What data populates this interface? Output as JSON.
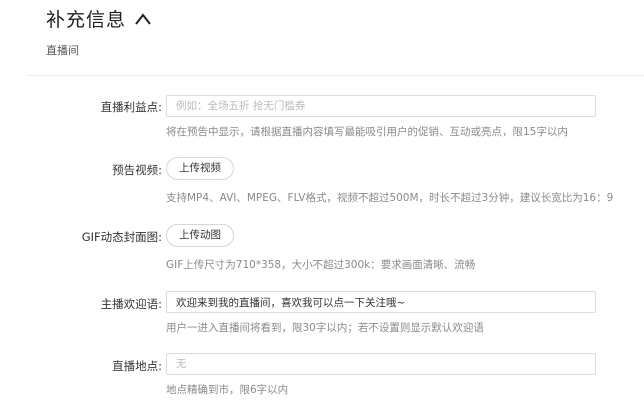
{
  "header": {
    "title": "补充信息"
  },
  "section": {
    "subtitle": "直播间"
  },
  "fields": {
    "selling_point": {
      "label": "直播利益点:",
      "placeholder": "例如：全场五折 抢无门槛券",
      "value": "",
      "hint": "将在预告中显示，请根据直播内容填写最能吸引用户的促销、互动或亮点，限15字以内"
    },
    "preview_video": {
      "label": "预告视频:",
      "button": "上传视频",
      "hint": "支持MP4、AVI、MPEG、FLV格式，视频不超过500M，时长不超过3分钟，建议长宽比为16：9"
    },
    "gif_cover": {
      "label": "GIF动态封面图:",
      "button": "上传动图",
      "hint": "GIF上传尺寸为710*358，大小不超过300k：要求画面清晰、流畅"
    },
    "welcome_message": {
      "label": "主播欢迎语:",
      "placeholder": "",
      "value": "欢迎来到我的直播间，喜欢我可以点一下关注哦~",
      "hint": "用户一进入直播间将看到，限30字以内；若不设置则显示默认欢迎语"
    },
    "location": {
      "label": "直播地点:",
      "placeholder": "无",
      "value": "",
      "hint": "地点精确到市，限6字以内"
    }
  }
}
